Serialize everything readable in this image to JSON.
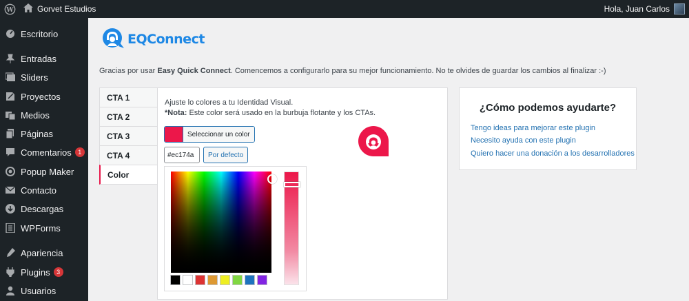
{
  "adminbar": {
    "site_name": "Gorvet Estudios",
    "greeting": "Hola, Juan Carlos"
  },
  "sidebar": {
    "items": [
      {
        "label": "Escritorio",
        "icon": "dashboard-icon"
      },
      {
        "label": "Entradas",
        "icon": "pin-icon"
      },
      {
        "label": "Sliders",
        "icon": "slides-icon"
      },
      {
        "label": "Proyectos",
        "icon": "portfolio-icon"
      },
      {
        "label": "Medios",
        "icon": "media-icon"
      },
      {
        "label": "Páginas",
        "icon": "page-icon"
      },
      {
        "label": "Comentarios",
        "icon": "comment-icon",
        "badge": "1"
      },
      {
        "label": "Popup Maker",
        "icon": "popup-icon"
      },
      {
        "label": "Contacto",
        "icon": "mail-icon"
      },
      {
        "label": "Descargas",
        "icon": "download-icon"
      },
      {
        "label": "WPForms",
        "icon": "forms-icon"
      },
      {
        "label": "Apariencia",
        "icon": "appearance-icon"
      },
      {
        "label": "Plugins",
        "icon": "plugin-icon",
        "badge": "3"
      },
      {
        "label": "Usuarios",
        "icon": "users-icon"
      }
    ]
  },
  "plugin": {
    "brand": "EQConnect",
    "intro_pre": "Gracias por usar ",
    "intro_bold": "Easy Quick Connect",
    "intro_post": ". Comencemos a configurarlo para su mejor funcionamiento. No te olvides de guardar los cambios al finalizar :-)"
  },
  "tabs": [
    "CTA 1",
    "CTA 2",
    "CTA 3",
    "CTA 4",
    "Color"
  ],
  "color_panel": {
    "line1": "Ajuste lo colores a tu Identidad Visual.",
    "note_bold": "*Nota:",
    "note_text": " Este color será usado en la burbuja flotante y los CTAs.",
    "select_label": "Seleccionar un color",
    "hex_value": "#ec174a",
    "default_label": "Por defecto",
    "accent": "#ec174a",
    "palette": [
      "#000000",
      "#ffffff",
      "#dd3333",
      "#dd9933",
      "#eeee22",
      "#81d742",
      "#1e73be",
      "#8224e3"
    ]
  },
  "help": {
    "title": "¿Cómo podemos ayudarte?",
    "links": [
      "Tengo ideas para mejorar este plugin",
      "Necesito ayuda con este plugin",
      "Quiero hacer una donación a los desarrolladores"
    ]
  }
}
